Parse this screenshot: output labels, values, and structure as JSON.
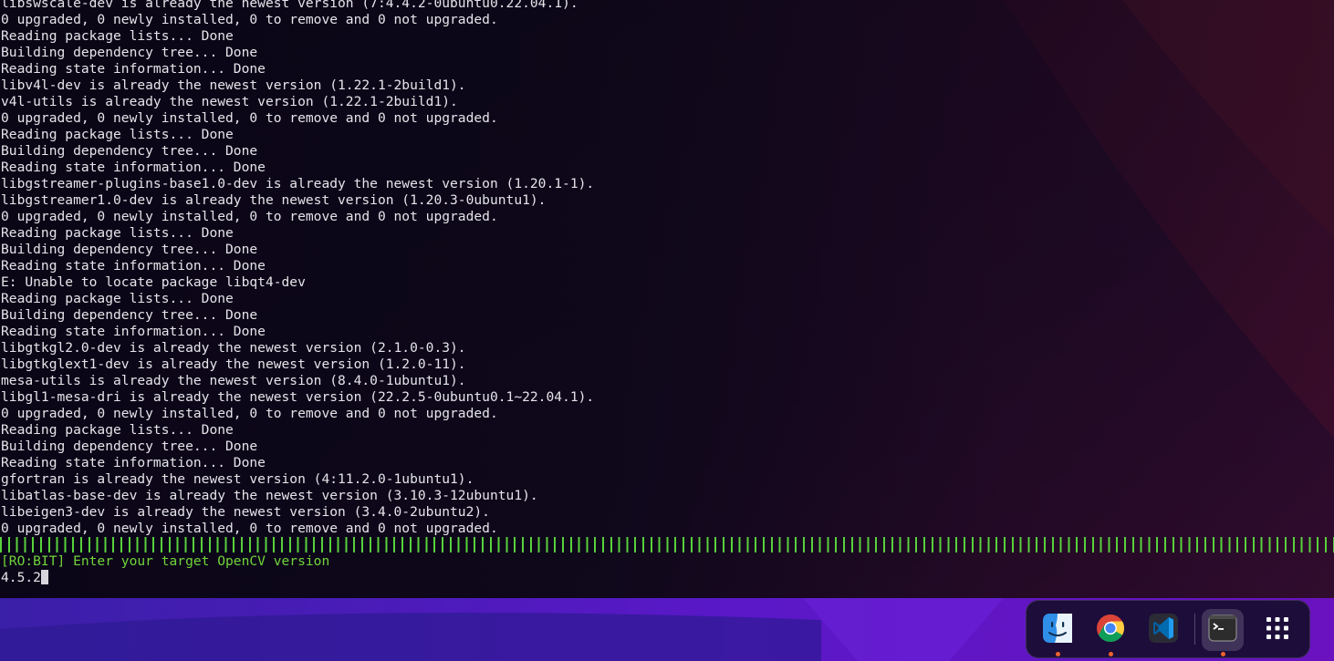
{
  "terminal": {
    "lines": [
      "libswscale-dev is already the newest version (7:4.4.2-0ubuntu0.22.04.1).",
      "0 upgraded, 0 newly installed, 0 to remove and 0 not upgraded.",
      "Reading package lists... Done",
      "Building dependency tree... Done",
      "Reading state information... Done",
      "libv4l-dev is already the newest version (1.22.1-2build1).",
      "v4l-utils is already the newest version (1.22.1-2build1).",
      "0 upgraded, 0 newly installed, 0 to remove and 0 not upgraded.",
      "Reading package lists... Done",
      "Building dependency tree... Done",
      "Reading state information... Done",
      "libgstreamer-plugins-base1.0-dev is already the newest version (1.20.1-1).",
      "libgstreamer1.0-dev is already the newest version (1.20.3-0ubuntu1).",
      "0 upgraded, 0 newly installed, 0 to remove and 0 not upgraded.",
      "Reading package lists... Done",
      "Building dependency tree... Done",
      "Reading state information... Done",
      "E: Unable to locate package libqt4-dev",
      "Reading package lists... Done",
      "Building dependency tree... Done",
      "Reading state information... Done",
      "libgtkgl2.0-dev is already the newest version (2.1.0-0.3).",
      "libgtkglext1-dev is already the newest version (1.2.0-11).",
      "mesa-utils is already the newest version (8.4.0-1ubuntu1).",
      "libgl1-mesa-dri is already the newest version (22.2.5-0ubuntu0.1~22.04.1).",
      "0 upgraded, 0 newly installed, 0 to remove and 0 not upgraded.",
      "Reading package lists... Done",
      "Building dependency tree... Done",
      "Reading state information... Done",
      "gfortran is already the newest version (4:11.2.0-1ubuntu1).",
      "libatlas-base-dev is already the newest version (3.10.3-12ubuntu1).",
      "libeigen3-dev is already the newest version (3.4.0-2ubuntu2).",
      "0 upgraded, 0 newly installed, 0 to remove and 0 not upgraded."
    ],
    "prompt": "[RO:BIT] Enter your target OpenCV version",
    "input_value": "4.5.2",
    "colors": {
      "text": "#e6e4ea",
      "prompt": "#6fd43a",
      "progress": "#58d13c"
    }
  },
  "dock": {
    "items": [
      {
        "name": "finder",
        "icon": "finder-face-icon",
        "running": true
      },
      {
        "name": "chrome",
        "icon": "chrome-icon",
        "running": true
      },
      {
        "name": "vscode",
        "icon": "vscode-icon",
        "running": false
      },
      {
        "name": "terminal",
        "icon": "terminal-icon",
        "running": true,
        "active": true
      },
      {
        "name": "show-applications",
        "icon": "app-grid-icon",
        "running": false
      }
    ],
    "indicator_color": "#f0632c"
  }
}
